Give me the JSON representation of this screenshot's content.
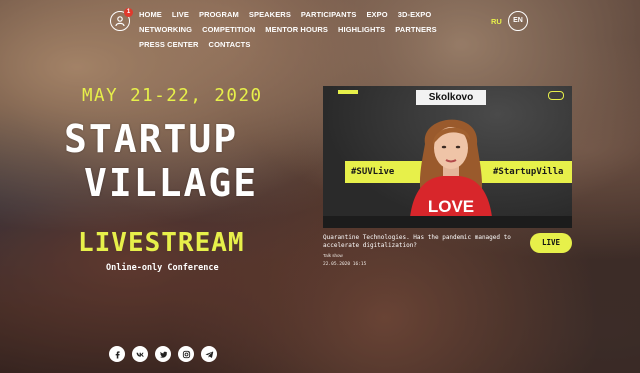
{
  "header": {
    "notification_count": "1",
    "nav": [
      "HOME",
      "LIVE",
      "PROGRAM",
      "SPEAKERS",
      "PARTICIPANTS",
      "EXPO",
      "3D-EXPO",
      "NETWORKING",
      "COMPETITION",
      "MENTOR HOURS",
      "HIGHLIGHTS",
      "PARTNERS",
      "PRESS CENTER",
      "CONTACTS"
    ],
    "lang_ru": "RU",
    "lang_en": "EN"
  },
  "hero": {
    "date": "MAY 21-22, 2020",
    "title_line1": "STARTUP",
    "title_line2": "VILLAGE",
    "livestream": "LIVESTREAM",
    "subtitle": "Online-only Conference"
  },
  "video": {
    "studio_sign": "Skolkovo",
    "banner_left": "#SUVLive",
    "banner_right": "#StartupVilla",
    "shirt_text": "LOVE",
    "caption_title": "Quarantine Technologies. Has the pandemic managed to accelerate digitalization?",
    "caption_tag": "Talk show",
    "caption_date": "22.05.2020 16:15",
    "live_label": "LIVE"
  },
  "social": [
    "facebook",
    "vk",
    "twitter",
    "instagram",
    "telegram"
  ],
  "colors": {
    "accent": "#e7f04a",
    "badge": "#e03a2d"
  }
}
